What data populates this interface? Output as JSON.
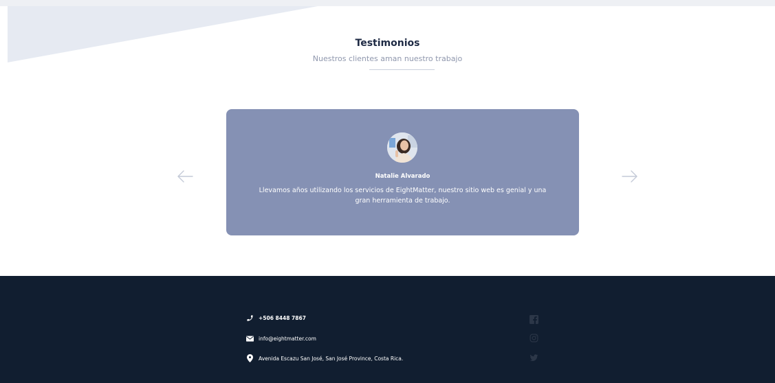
{
  "testimonials": {
    "title": "Testimonios",
    "subtitle": "Nuestros clientes aman nuestro trabajo",
    "prev_icon": "arrow-left-icon",
    "next_icon": "arrow-right-icon",
    "current": {
      "name": "Natalie Alvarado",
      "quote": "Llevamos años utilizando los servicios de EightMatter, nuestro sitio web es genial y una gran herramienta de trabajo.",
      "card_color": "#8591b4"
    }
  },
  "footer": {
    "background": "#111e30",
    "contacts": {
      "phone": {
        "icon": "phone-icon",
        "text": "+506 8448 7867"
      },
      "email": {
        "icon": "envelope-icon",
        "text": "info@eightmatter.com"
      },
      "address": {
        "icon": "map-pin-icon",
        "text": "Avenida Escazu San José, San José Province, Costa Rica."
      }
    },
    "social": [
      "facebook-icon",
      "instagram-icon",
      "twitter-icon"
    ]
  }
}
